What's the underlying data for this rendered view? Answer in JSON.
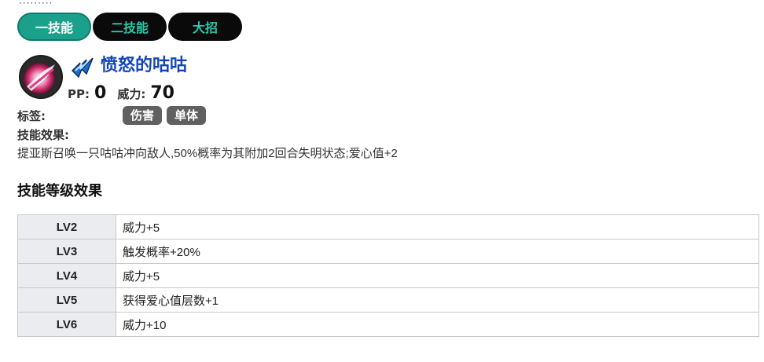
{
  "tabs": [
    {
      "label": "一技能",
      "active": true
    },
    {
      "label": "二技能",
      "active": false
    },
    {
      "label": "大招",
      "active": false
    }
  ],
  "skill": {
    "name": "愤怒的咕咕",
    "pp_label": "PP:",
    "pp_value": "0",
    "power_label": "威力:",
    "power_value": "70",
    "tags_label": "标签:",
    "tags": [
      "伤害",
      "单体"
    ],
    "effect_label": "技能效果:",
    "effect_desc": "提亚斯召唤一只咕咕冲向敌人,50%概率为其附加2回合失明状态;爱心值+2",
    "icon": "skill-crystal-icon",
    "type_icon": "ice-type-icon"
  },
  "level_section": {
    "title": "技能等级效果",
    "rows": [
      {
        "level": "LV2",
        "effect": "威力+5"
      },
      {
        "level": "LV3",
        "effect": "触发概率+20%"
      },
      {
        "level": "LV4",
        "effect": "威力+5"
      },
      {
        "level": "LV5",
        "effect": "获得爱心值层数+1"
      },
      {
        "level": "LV6",
        "effect": "威力+10"
      }
    ]
  },
  "colors": {
    "tab_active": "#1aa08b",
    "tab_inactive": "#0a0a0a",
    "tab_inactive_text": "#2dc7ab",
    "skill_name": "#1446b8",
    "tag_bg": "#606060",
    "table_header_bg": "#eaecf0"
  }
}
